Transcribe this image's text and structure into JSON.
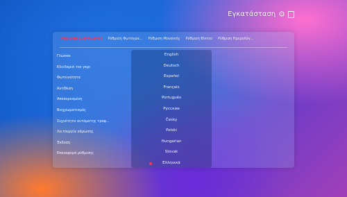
{
  "header": {
    "title": "Εγκατάσταση"
  },
  "tabs": [
    {
      "label": "Ρύθμιση Συστήματος",
      "active": true
    },
    {
      "label": "Ρύθμιση Φωτογρα..."
    },
    {
      "label": "Ρύθμιση Μουσικής"
    },
    {
      "label": "Ρύθμιση Βίντεο"
    },
    {
      "label": "Ρύθμιση Ημερολόγ..."
    }
  ],
  "settings": [
    "Γλώσσα",
    "Κλειδαριά του γκρι",
    "Φωτεινότητα",
    "Αντίθεση",
    "Αποκορεσμένη",
    "Βιοχρωματισμός",
    "Συχνότητα αυτόματης τροφ...",
    "Λειτουργία σάρωσης",
    "Έκδοση",
    "Επαναφορά ρύθμισης"
  ],
  "languages": [
    "English",
    "Deutsch",
    "Español",
    "Français",
    "Português",
    "Pyccкии",
    "Česky",
    "Polski",
    "Hungarian",
    "Slovak",
    "Ελληνικά"
  ],
  "selected_language": "Ελληνικά",
  "colors": {
    "accent": "#ff3355"
  }
}
